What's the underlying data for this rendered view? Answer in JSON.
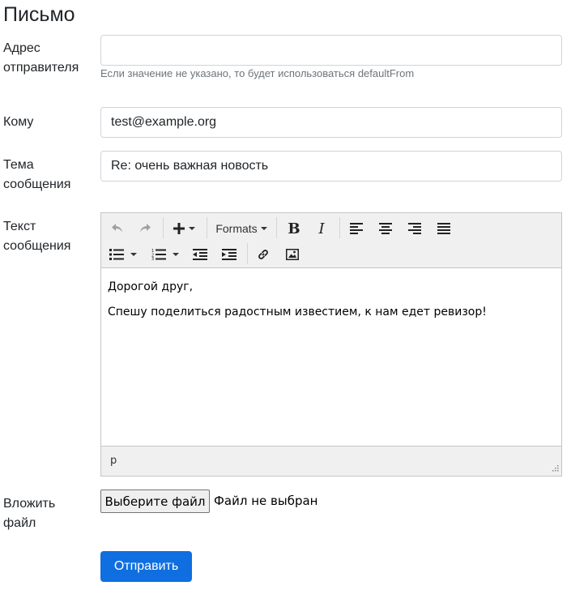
{
  "page": {
    "title": "Письмо"
  },
  "form": {
    "sender": {
      "label_line1": "Адрес",
      "label_line2": "отправителя",
      "value": "",
      "placeholder": "",
      "help": "Если значение не указано, то будет использоваться defaultFrom"
    },
    "to": {
      "label": "Кому",
      "value": "test@example.org"
    },
    "subject": {
      "label_line1": "Тема",
      "label_line2": "сообщения",
      "value": "Re: очень важная новость"
    },
    "body": {
      "label_line1": "Текст",
      "label_line2": "сообщения"
    },
    "attach": {
      "label_line1": "Вложить",
      "label_line2": "файл",
      "button": "Выберите файл",
      "status": "Файл не выбран"
    },
    "submit": "Отправить"
  },
  "editor": {
    "toolbar": {
      "formats_label": "Formats",
      "icons": [
        "undo-icon",
        "redo-icon",
        "insert-icon",
        "bold-icon",
        "italic-icon",
        "align-left-icon",
        "align-center-icon",
        "align-right-icon",
        "align-justify-icon",
        "bullet-list-icon",
        "numbered-list-icon",
        "outdent-icon",
        "indent-icon",
        "link-icon",
        "image-icon"
      ]
    },
    "content": [
      "Дорогой друг,",
      "Спешу поделиться радостным известием, к нам едет ревизор!"
    ],
    "statusbar_path": "p"
  },
  "colors": {
    "primary": "#0f6fe0",
    "toolbar_bg": "#f0f0f0",
    "border": "#ced4da"
  }
}
